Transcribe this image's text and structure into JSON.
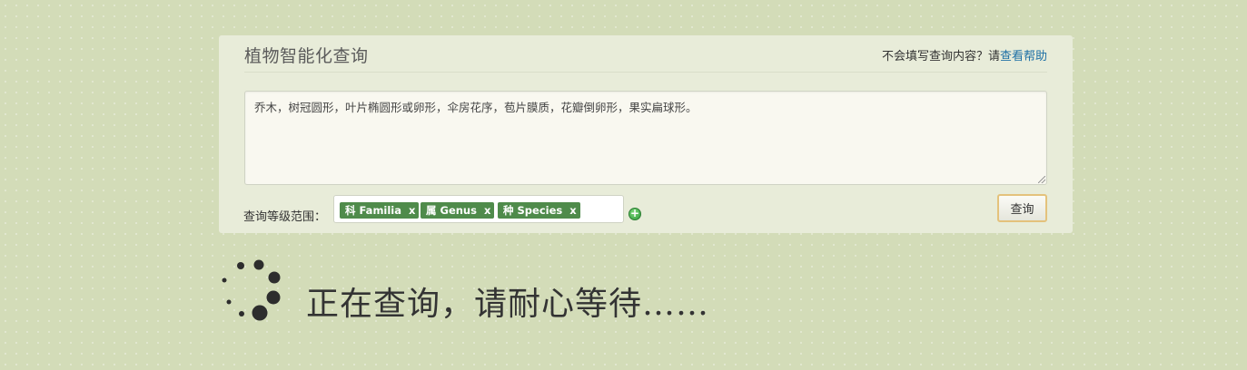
{
  "panel": {
    "title": "植物智能化查询",
    "help_prefix": "不会填写查询内容？请",
    "help_link": "查看帮助"
  },
  "query": {
    "text": "乔木，树冠圆形，叶片椭圆形或卵形，伞房花序，苞片膜质，花瓣倒卵形，果实扁球形。"
  },
  "level": {
    "label": "查询等级范围：",
    "tags": [
      {
        "label": "科 Familia",
        "remove": "x"
      },
      {
        "label": "属 Genus",
        "remove": "x"
      },
      {
        "label": "种 Species",
        "remove": "x"
      }
    ],
    "add_icon": "add-circle-icon"
  },
  "actions": {
    "query_button": "查询"
  },
  "loading": {
    "spinner_icon": "loading-spinner-icon",
    "message": "正在查询，请耐心等待……"
  },
  "colors": {
    "background": "#d3dcb8",
    "panel": "#e8ecd9",
    "tag": "#4f8b4b",
    "link": "#1d6fa5",
    "button_border": "#e4c27c"
  }
}
